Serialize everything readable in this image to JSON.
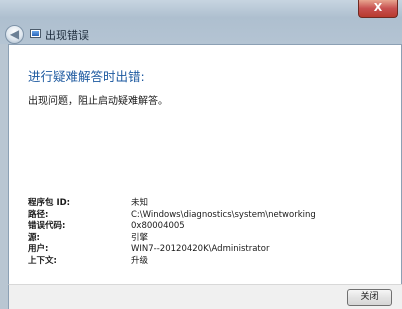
{
  "window": {
    "title": "出现错误",
    "close_glyph": "X"
  },
  "content": {
    "heading": "进行疑难解答时出错:",
    "description": "出现问题，阻止启动疑难解答。"
  },
  "details": [
    {
      "key": "程序包 ID:",
      "value": "未知"
    },
    {
      "key": "路径:",
      "value": "C:\\Windows\\diagnostics\\system\\networking"
    },
    {
      "key": "错误代码:",
      "value": "0x80004005"
    },
    {
      "key": "源:",
      "value": "引擎"
    },
    {
      "key": "用户:",
      "value": "WIN7--20120420K\\Administrator"
    },
    {
      "key": "上下文:",
      "value": "升级"
    }
  ],
  "footer": {
    "close_label": "关闭"
  },
  "colors": {
    "heading": "#1e5aa0",
    "title_bar": "#b4c4d3"
  }
}
